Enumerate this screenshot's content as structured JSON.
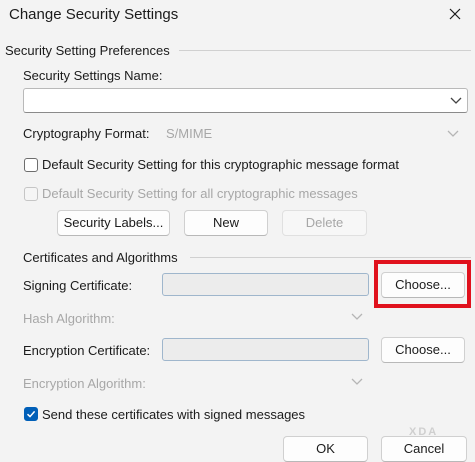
{
  "window": {
    "title": "Change Security Settings"
  },
  "preferences": {
    "group_title": "Security Setting Preferences",
    "name_label": "Security Settings Name:",
    "name_value": "",
    "crypto_format_label": "Cryptography Format:",
    "crypto_format_value": "S/MIME",
    "default_format_label": "Default Security Setting for this cryptographic message format",
    "default_all_label": "Default Security Setting for all cryptographic messages",
    "security_labels_button": "Security Labels...",
    "new_button": "New",
    "delete_button": "Delete"
  },
  "certificates": {
    "group_title": "Certificates and Algorithms",
    "signing_label": "Signing Certificate:",
    "signing_value": "",
    "signing_choose": "Choose...",
    "hash_label": "Hash Algorithm:",
    "hash_value": "",
    "encryption_label": "Encryption Certificate:",
    "encryption_value": "",
    "encryption_choose": "Choose...",
    "enc_algo_label": "Encryption Algorithm:",
    "enc_algo_value": "",
    "send_certs_label": "Send these certificates with signed messages",
    "send_certs_checked": true
  },
  "footer": {
    "ok": "OK",
    "cancel": "Cancel"
  },
  "watermark": "XDA",
  "colors": {
    "highlight": "#e0111d",
    "accent": "#005fb8"
  }
}
